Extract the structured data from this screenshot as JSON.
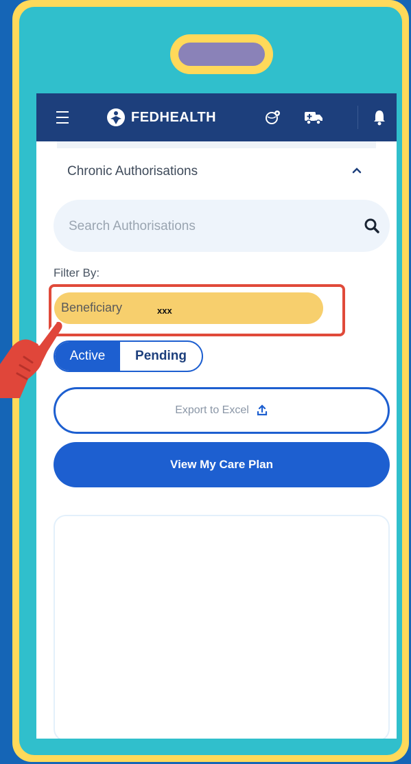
{
  "app": {
    "brand": "FEDHEALTH"
  },
  "section": {
    "title": "Chronic Authorisations"
  },
  "search": {
    "placeholder": "Search Authorisations",
    "value": ""
  },
  "filter": {
    "label": "Filter By:",
    "beneficiary_label": "Beneficiary",
    "beneficiary_value": "xxx"
  },
  "status_toggle": {
    "active_label": "Active",
    "pending_label": "Pending",
    "selected": "Active"
  },
  "actions": {
    "export_label": "Export to Excel",
    "care_plan_label": "View My Care Plan"
  },
  "icons": {
    "menu": "hamburger-menu-icon",
    "logo": "fedhealth-logo-icon",
    "globe": "globe-location-icon",
    "ambulance": "ambulance-icon",
    "bell": "notification-bell-icon",
    "caret": "chevron-up-icon",
    "search": "search-icon",
    "export": "upload-icon",
    "pointer": "pointing-hand-icon"
  },
  "colors": {
    "navbar": "#1d3f7c",
    "primary": "#1d5fd0",
    "highlight": "#e04a3a",
    "beneficiary_pill": "#f7cf6d",
    "frame_outer": "#ffd95a",
    "frame_inner": "#30bfcc",
    "background": "#1565b6"
  }
}
